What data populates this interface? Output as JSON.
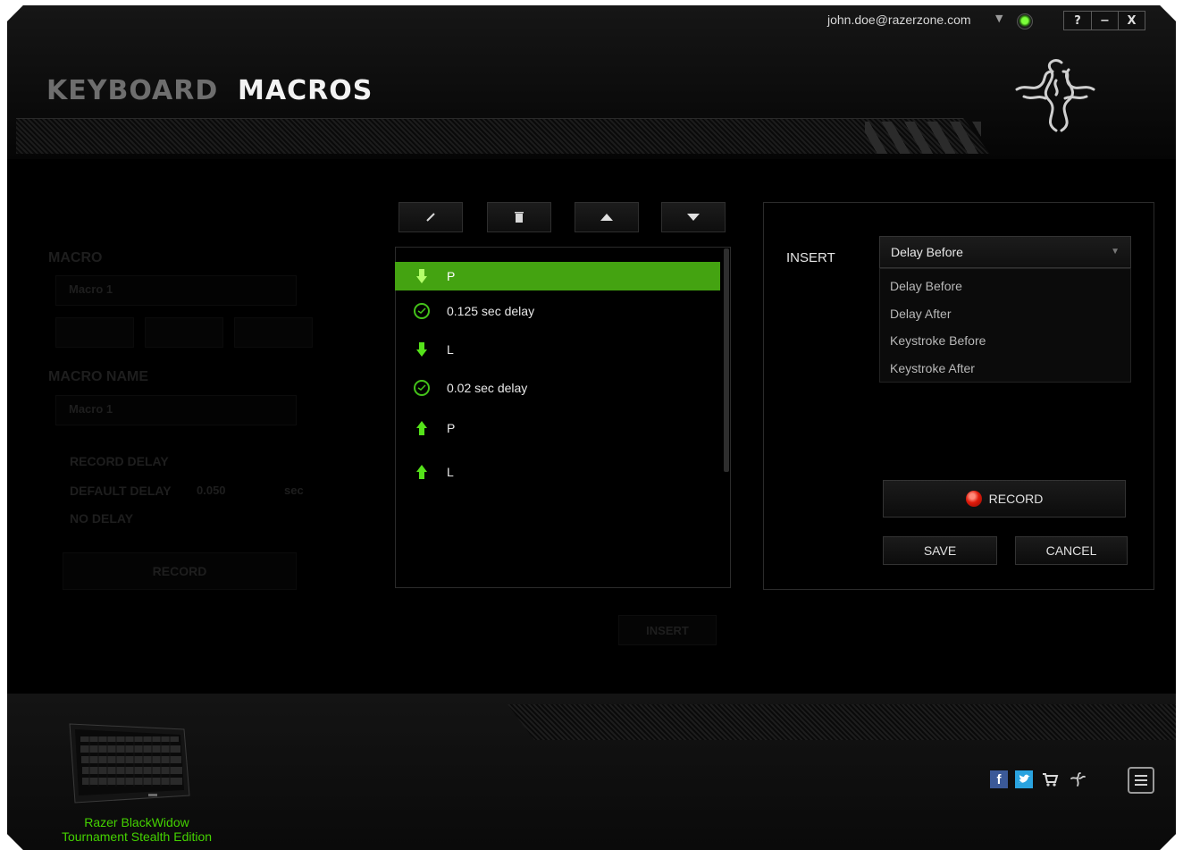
{
  "account": {
    "email": "john.doe@razerzone.com"
  },
  "window_controls": [
    "?",
    "−",
    "X"
  ],
  "tabs": [
    {
      "label": "KEYBOARD",
      "active": false
    },
    {
      "label": "MACROS",
      "active": true
    }
  ],
  "left_panel": {
    "macro_label": "MACRO",
    "macro_value": "Macro 1",
    "macro_name_label": "MACRO NAME",
    "macro_name_value": "Macro 1",
    "options": [
      "RECORD DELAY",
      "DEFAULT DELAY",
      "NO DELAY"
    ],
    "default_delay_value": "0.050",
    "default_delay_unit": "sec",
    "record_label": "RECORD",
    "insert_label": "INSERT"
  },
  "toolbar": [
    "edit-icon",
    "trash-icon",
    "arrow-up-icon",
    "arrow-down-icon"
  ],
  "events": [
    {
      "type": "key-down",
      "label": "P",
      "selected": true
    },
    {
      "type": "delay",
      "label": "0.125 sec delay",
      "selected": false
    },
    {
      "type": "key-down",
      "label": "L",
      "selected": false
    },
    {
      "type": "delay",
      "label": "0.02 sec delay",
      "selected": false
    },
    {
      "type": "key-up",
      "label": "P",
      "selected": false
    },
    {
      "type": "key-up",
      "label": "L",
      "selected": false
    }
  ],
  "insert_panel": {
    "label": "INSERT",
    "selected": "Delay Before",
    "options": [
      "Delay Before",
      "Delay After",
      "Keystroke Before",
      "Keystroke After"
    ],
    "record_label": "RECORD",
    "save_label": "SAVE",
    "cancel_label": "CANCEL"
  },
  "device": {
    "name_line1": "Razer BlackWidow",
    "name_line2": "Tournament Stealth Edition"
  },
  "colors": {
    "accent_green": "#44a311",
    "device_text_green": "#44d200",
    "record_red": "#e01b0b"
  }
}
